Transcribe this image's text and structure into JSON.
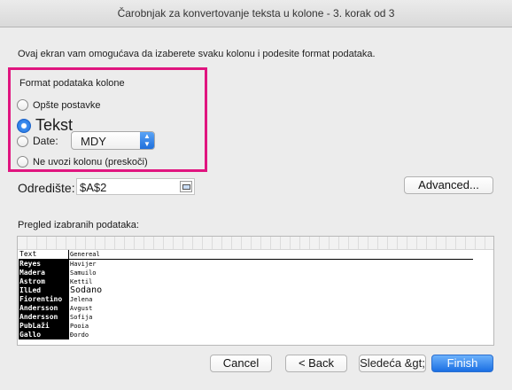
{
  "window": {
    "title": "Čarobnjak za konvertovanje teksta u kolone - 3. korak od 3"
  },
  "description": "Ovaj ekran vam omogućava da izaberete svaku kolonu i podesite format podataka.",
  "format_section": {
    "label": "Format podataka kolone",
    "options": [
      {
        "label": "Opšte postavke",
        "checked": false
      },
      {
        "label": "Tekst",
        "checked": true
      },
      {
        "label": "Date:",
        "checked": false
      },
      {
        "label": "Ne uvozi kolonu (preskoči)",
        "checked": false
      }
    ],
    "date_format": {
      "selected": "MDY"
    }
  },
  "destination": {
    "label": "Odredište:",
    "value": "$A$2"
  },
  "advanced_button": "Advanced...",
  "preview": {
    "label": "Pregled izabranih podataka:",
    "header": [
      "Text",
      "Genereal"
    ],
    "rows": [
      [
        "Reyes",
        "Havijer"
      ],
      [
        "Madera",
        "Samuilo"
      ],
      [
        "Astrom",
        "Kettil"
      ],
      [
        "IlLed",
        "Sodano"
      ],
      [
        "Fiorentino",
        "Jelena"
      ],
      [
        "Andersson",
        "Avgust"
      ],
      [
        "Andersson",
        "Sofija"
      ],
      [
        "PubLaži",
        "Pooia"
      ],
      [
        "Gallo",
        "Đordo"
      ]
    ]
  },
  "buttons": {
    "cancel": "Cancel",
    "back": "< Back",
    "next": "Sledeća &gt;",
    "finish": "Finish"
  },
  "colors": {
    "highlight": "#e0157f",
    "accent": "#1f6fdb"
  }
}
